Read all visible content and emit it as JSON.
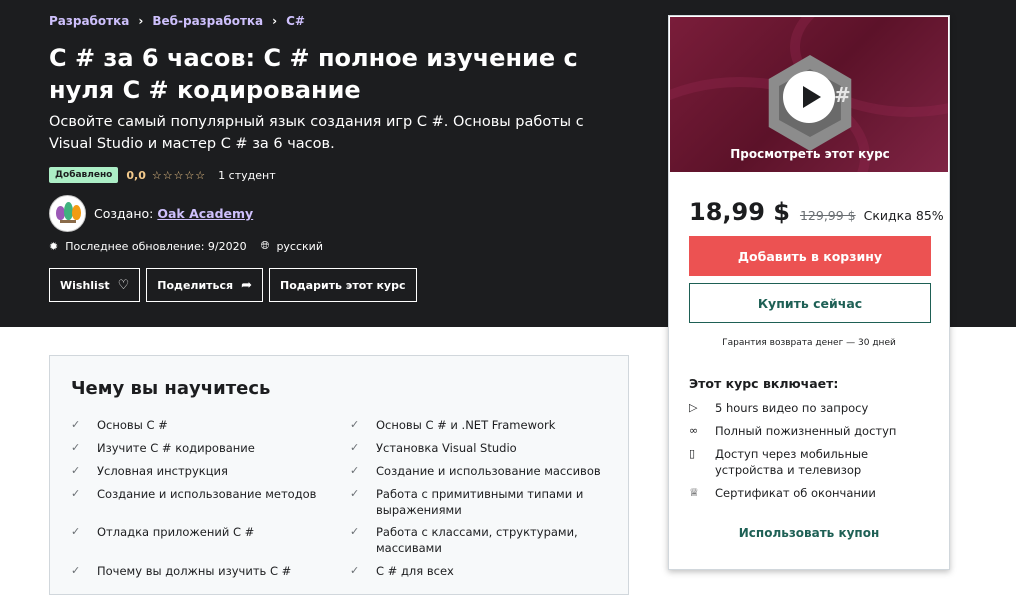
{
  "breadcrumb": [
    "Разработка",
    "Веб-разработка",
    "C#"
  ],
  "breadcrumb_sep": "›",
  "course": {
    "title": "C # за 6 часов: C # полное изучение с нуля C # кодирование",
    "subtitle": "Освойте самый популярный язык создания игр C #. Основы работы с Visual Studio и мастер C # за 6 часов.",
    "badge": "Добавлено",
    "rating": "0,0",
    "stars": "☆☆☆☆☆",
    "students": "1 студент",
    "created_by_label": "Создано:",
    "author": "Oak Academy",
    "last_update": "Последнее обновление: 9/2020",
    "language": "русский"
  },
  "actions": {
    "wishlist": "Wishlist",
    "share": "Поделиться",
    "gift": "Подарить этот курс"
  },
  "sidebar": {
    "preview_label": "Просмотреть этот курс",
    "price": "18,99 $",
    "old_price": "129,99 $",
    "discount": "Скидка 85%",
    "add_to_cart": "Добавить в корзину",
    "buy_now": "Купить сейчас",
    "guarantee": "Гарантия возврата денег — 30 дней",
    "includes_title": "Этот курс включает:",
    "includes": [
      {
        "icon": "video-icon",
        "text": "5 hours видео по запросу"
      },
      {
        "icon": "infinity-icon",
        "text": "Полный пожизненный доступ"
      },
      {
        "icon": "mobile-icon",
        "text": "Доступ через мобильные устройства и телевизор"
      },
      {
        "icon": "certificate-icon",
        "text": "Сертификат об окончании"
      }
    ],
    "coupon": "Использовать купон"
  },
  "learn": {
    "title": "Чему вы научитесь",
    "left": [
      "Основы C #",
      "Изучите C # кодирование",
      "Условная инструкция",
      "Создание и использование методов",
      "Отладка приложений C #",
      "Почему вы должны изучить C #"
    ],
    "right": [
      "Основы C # и .NET Framework",
      "Установка Visual Studio",
      "Создание и использование массивов",
      "Работа с примитивными типами и выражениями",
      "Работа с классами, структурами, массивами",
      "C # для всех"
    ]
  }
}
